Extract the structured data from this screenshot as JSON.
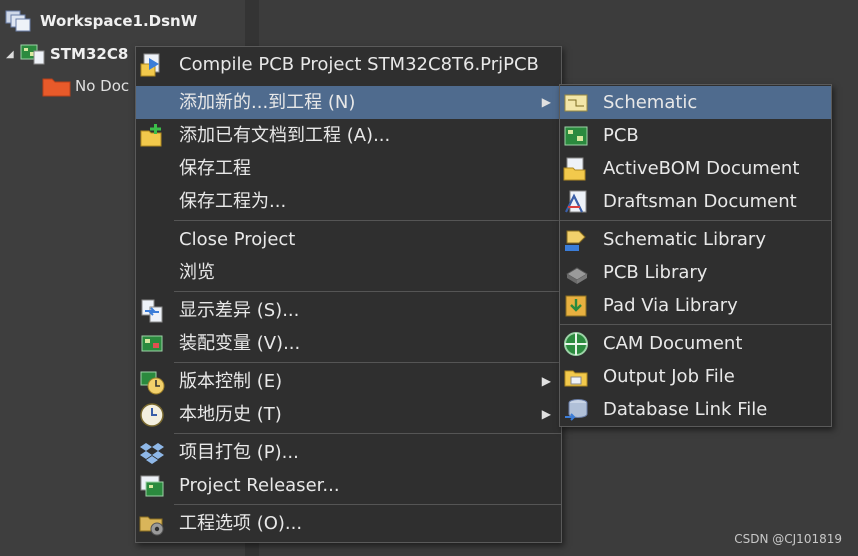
{
  "tree": {
    "workspace_label": "Workspace1.DsnW",
    "project_label": "STM32C8",
    "no_doc_label": "No Doc"
  },
  "context_menu": {
    "items": [
      {
        "label": "Compile PCB Project STM32C8T6.PrjPCB",
        "icon": "compile-icon"
      },
      {
        "label": "添加新的...到工程 (N)",
        "icon": "",
        "submenu": true
      },
      {
        "label": "添加已有文档到工程 (A)...",
        "icon": "add-existing-icon"
      },
      {
        "label": "保存工程",
        "icon": ""
      },
      {
        "label": "保存工程为...",
        "icon": ""
      },
      {
        "label": "Close Project",
        "icon": ""
      },
      {
        "label": "浏览",
        "icon": ""
      },
      {
        "label": "显示差异 (S)...",
        "icon": "show-diff-icon"
      },
      {
        "label": "装配变量 (V)...",
        "icon": "variants-icon"
      },
      {
        "label": "版本控制 (E)",
        "icon": "version-control-icon",
        "submenu": true
      },
      {
        "label": "本地历史 (T)",
        "icon": "history-icon",
        "submenu": true
      },
      {
        "label": "项目打包 (P)...",
        "icon": "dropbox-icon"
      },
      {
        "label": "Project Releaser...",
        "icon": "releaser-icon"
      },
      {
        "label": "工程选项 (O)...",
        "icon": "options-icon"
      }
    ]
  },
  "submenu": {
    "items": [
      {
        "label": "Schematic",
        "icon": "schematic-icon"
      },
      {
        "label": "PCB",
        "icon": "pcb-icon"
      },
      {
        "label": "ActiveBOM Document",
        "icon": "bom-icon"
      },
      {
        "label": "Draftsman Document",
        "icon": "draftsman-icon"
      },
      {
        "label": "Schematic Library",
        "icon": "schlib-icon"
      },
      {
        "label": "PCB Library",
        "icon": "pcblib-icon"
      },
      {
        "label": "Pad Via Library",
        "icon": "padvia-icon"
      },
      {
        "label": "CAM Document",
        "icon": "cam-icon"
      },
      {
        "label": "Output Job File",
        "icon": "outjob-icon"
      },
      {
        "label": "Database Link File",
        "icon": "dblink-icon"
      }
    ]
  },
  "watermark": "CSDN @CJ101819",
  "colors": {
    "highlight": "#4f6b8e",
    "menu_bg": "#2f2f2f",
    "panel_bg": "#3e3e3e"
  }
}
